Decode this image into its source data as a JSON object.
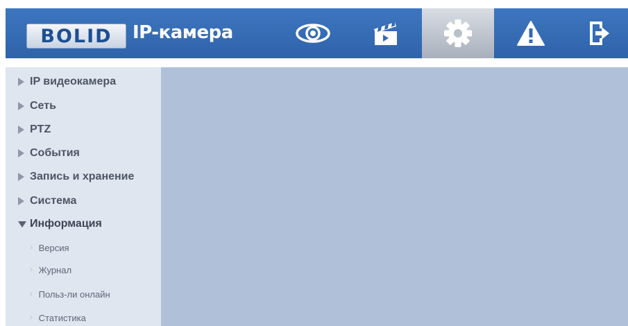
{
  "header": {
    "logo_text": "BOLID",
    "title": "IP-камера",
    "nav": [
      {
        "name": "live-view",
        "icon": "eye-icon"
      },
      {
        "name": "playback",
        "icon": "clapperboard-icon"
      },
      {
        "name": "settings",
        "icon": "gear-icon",
        "active": true
      },
      {
        "name": "alarm",
        "icon": "warning-icon"
      },
      {
        "name": "logout",
        "icon": "exit-icon"
      }
    ]
  },
  "sidebar": {
    "items": [
      {
        "label": "IP видеокамера"
      },
      {
        "label": "Сеть"
      },
      {
        "label": "PTZ"
      },
      {
        "label": "События"
      },
      {
        "label": "Запись и хранение"
      },
      {
        "label": "Система"
      },
      {
        "label": "Информация",
        "expanded": true
      }
    ],
    "subitems": [
      {
        "label": "Версия"
      },
      {
        "label": "Журнал"
      },
      {
        "label": "Польз-ли онлайн"
      },
      {
        "label": "Статистика"
      }
    ]
  },
  "colors": {
    "header": "#3568b1",
    "sidebar": "#e0e6ef",
    "content": "#b0c0d8"
  }
}
